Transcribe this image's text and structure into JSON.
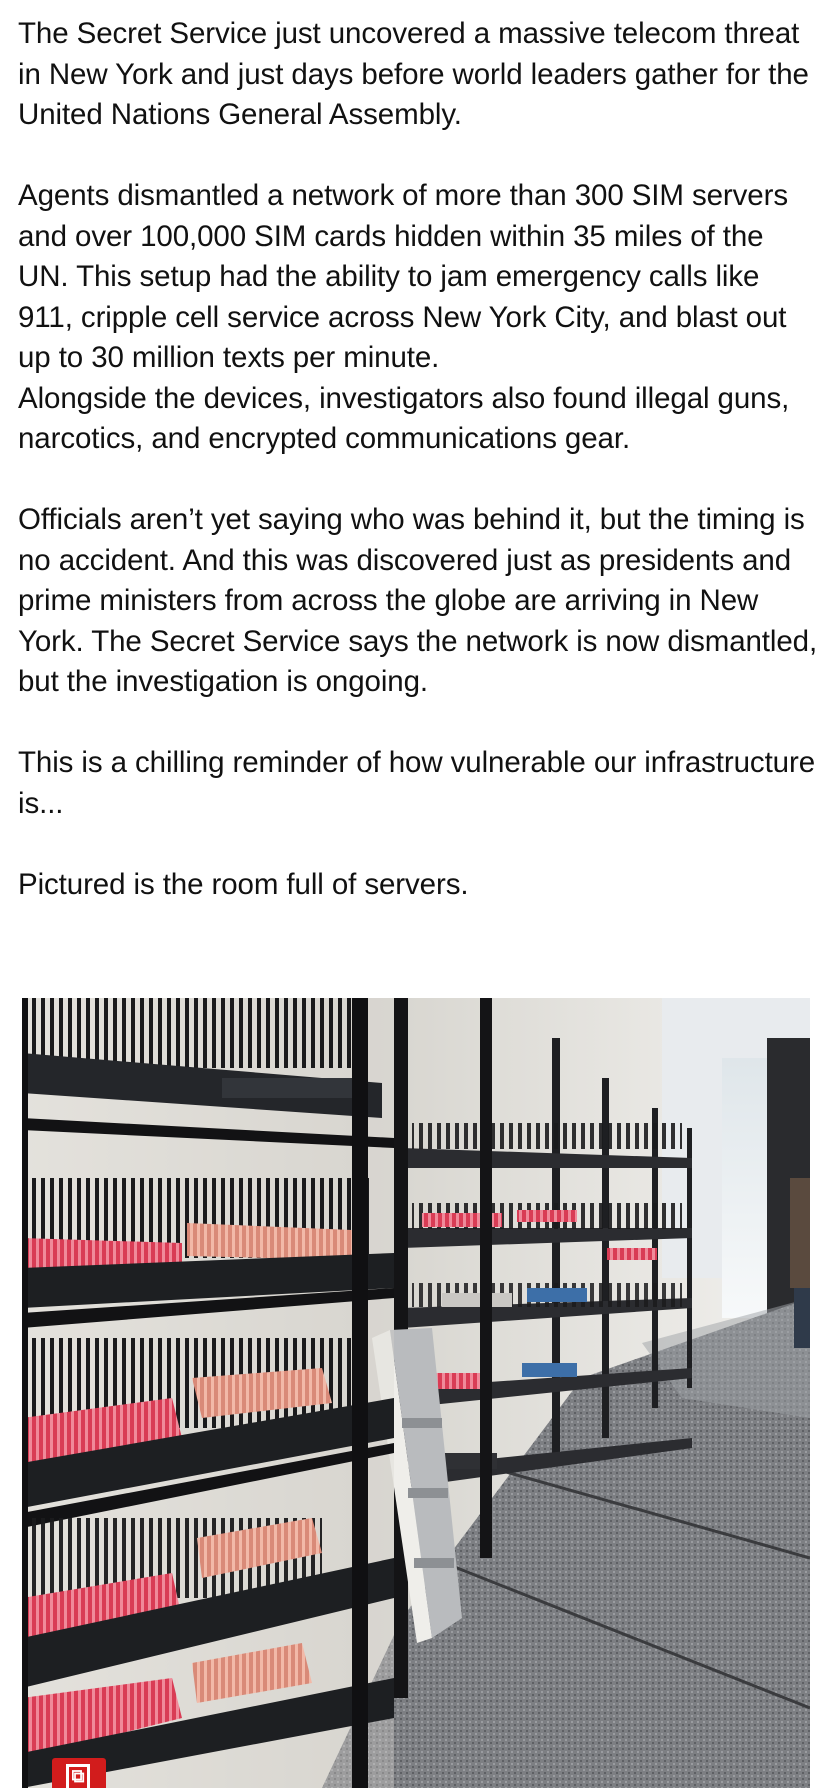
{
  "post": {
    "paragraphs": [
      "The Secret Service just uncovered a massive telecom threat in New York and just days before world leaders gather for the United Nations General Assembly.",
      "Agents dismantled a network of more than 300 SIM servers and over 100,000 SIM cards hidden within 35 miles of the UN. This setup had the ability to jam emergency calls like 911, cripple cell service across New York City, and blast out up to 30 million texts per minute.",
      "Alongside the devices, investigators also found illegal guns, narcotics, and encrypted communications gear.",
      "Officials aren’t yet saying who was behind it, but the timing is no accident. And this was discovered just as presidents and prime ministers from across the globe are arriving in New York. The Secret Service says the network is now dismantled, but the investigation is ongoing.",
      "This is a chilling reminder of how vulnerable our infrastructure is...",
      "Pictured is the room full of servers."
    ]
  },
  "photo": {
    "subject": "room-of-sim-server-racks",
    "badge_icon": "gallery-count-icon",
    "badge_color": "#d21c1c"
  }
}
